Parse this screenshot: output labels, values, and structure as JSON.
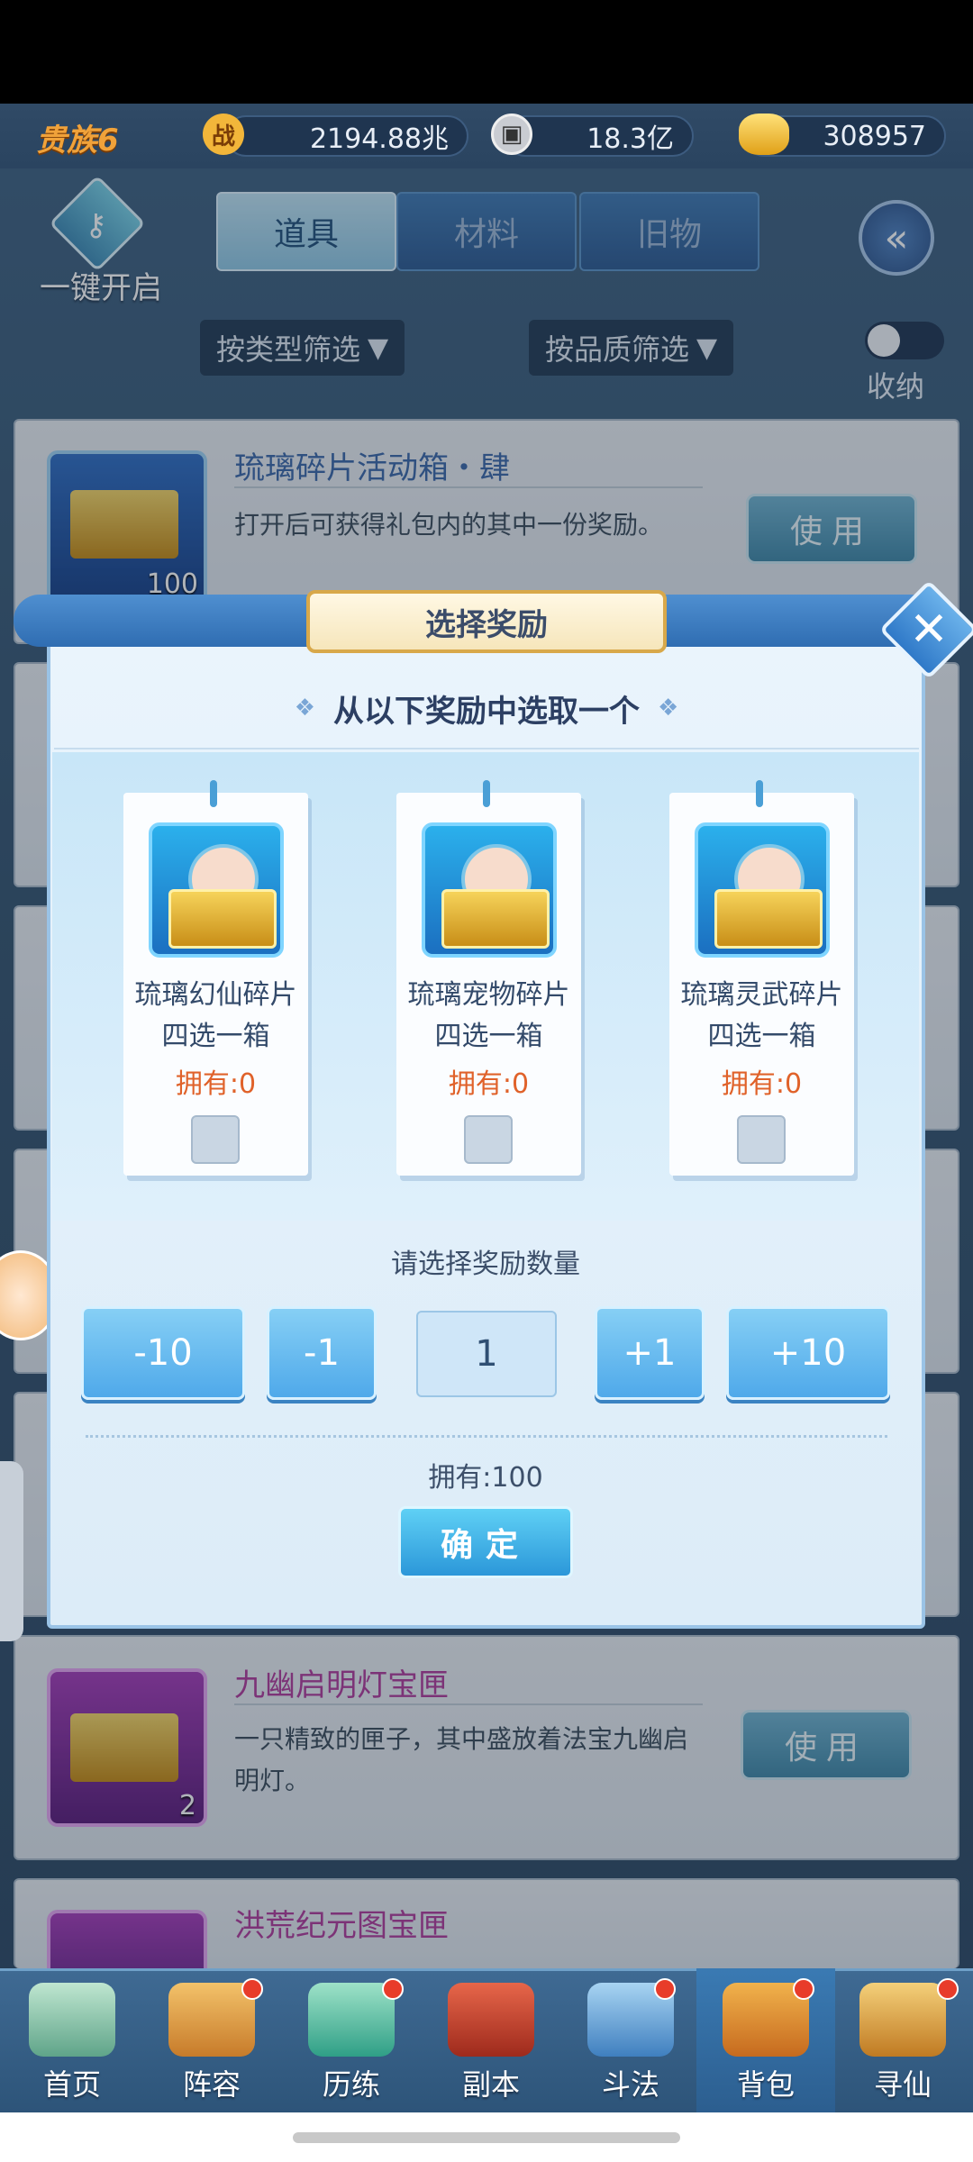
{
  "header": {
    "rank": "贵族6",
    "power_icon_label": "战",
    "power": "2194.88兆",
    "coins": "18.3亿",
    "ingots": "308957"
  },
  "top": {
    "one_key_open": "一键开启",
    "tabs": [
      "道具",
      "材料",
      "旧物"
    ],
    "filter_type": "按类型筛选",
    "filter_quality": "按品质筛选",
    "collapse_label": "收纳"
  },
  "items": [
    {
      "title": "琉璃碎片活动箱・肆",
      "desc": "打开后可获得礼包内的其中一份奖励。",
      "count": "100",
      "use": "使用"
    },
    {
      "title": "九幽启明灯宝匣",
      "desc": "一只精致的匣子，其中盛放着法宝九幽启明灯。",
      "count": "2",
      "use": "使用"
    },
    {
      "title": "洪荒纪元图宝匣"
    }
  ],
  "modal": {
    "title": "选择奖励",
    "subtitle": "从以下奖励中选取一个",
    "choices": [
      {
        "name": "琉璃幻仙碎片四选一箱",
        "owned": "拥有:0"
      },
      {
        "name": "琉璃宠物碎片四选一箱",
        "owned": "拥有:0"
      },
      {
        "name": "琉璃灵武碎片四选一箱",
        "owned": "拥有:0"
      }
    ],
    "qty_label": "请选择奖励数量",
    "minus10": "-10",
    "minus1": "-1",
    "quantity": "1",
    "plus1": "+1",
    "plus10": "+10",
    "owned_total": "拥有:100",
    "confirm": "确定"
  },
  "nav": [
    "首页",
    "阵容",
    "历练",
    "副本",
    "斗法",
    "背包",
    "寻仙"
  ],
  "colors": {
    "accent": "#2f79c8",
    "gold": "#f0a23a",
    "owned": "#e0622a"
  }
}
